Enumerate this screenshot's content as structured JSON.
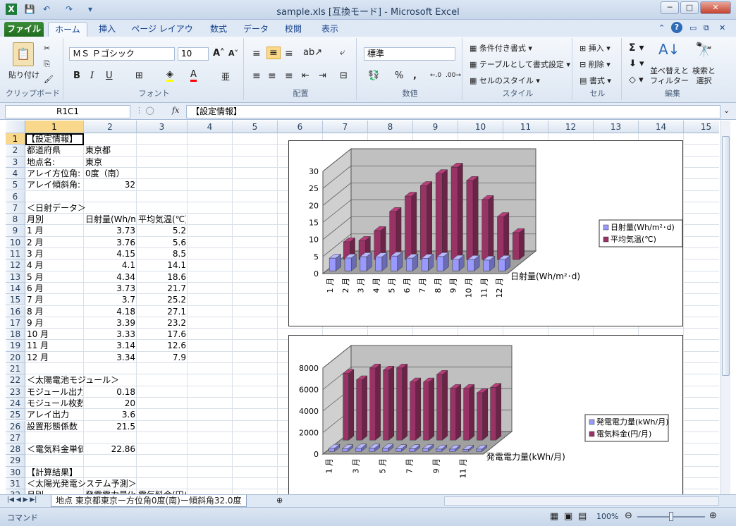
{
  "window": {
    "title": "sample.xls  [互換モード] - Microsoft Excel"
  },
  "tabs": [
    "ファイル",
    "ホーム",
    "挿入",
    "ページ レイアウト",
    "数式",
    "データ",
    "校閲",
    "表示"
  ],
  "ribbon": {
    "clipboard": {
      "label": "クリップボード",
      "paste": "貼り付け"
    },
    "font": {
      "label": "フォント",
      "name": "ＭＳ Ｐゴシック",
      "size": "10",
      "bold": "B",
      "italic": "I",
      "underline": "U"
    },
    "align": {
      "label": "配置"
    },
    "number": {
      "label": "数値",
      "format": "標準",
      "percent": "%",
      "comma": ","
    },
    "styles": {
      "label": "スタイル",
      "cond": "条件付き書式",
      "table": "テーブルとして書式設定",
      "cell": "セルのスタイル"
    },
    "cells": {
      "label": "セル",
      "insert": "挿入",
      "delete": "削除",
      "format": "書式"
    },
    "edit": {
      "label": "編集",
      "sort": "並べ替えと\nフィルター",
      "find": "検索と\n選択"
    }
  },
  "formula_bar": {
    "name_box": "R1C1",
    "fx": "fx",
    "value": "【設定情報】"
  },
  "columns": [
    "1",
    "2",
    "3",
    "4",
    "5",
    "6",
    "7",
    "8",
    "9",
    "10",
    "11",
    "12",
    "13",
    "14",
    "15"
  ],
  "rows": [
    {
      "n": "1",
      "a": "【設定情報】",
      "b": "",
      "c": ""
    },
    {
      "n": "2",
      "a": "都道府県",
      "b": "東京都",
      "c": ""
    },
    {
      "n": "3",
      "a": "地点名:",
      "b": "東京",
      "c": ""
    },
    {
      "n": "4",
      "a": "アレイ方位角:",
      "b": "0度（南）",
      "c": ""
    },
    {
      "n": "5",
      "a": "アレイ傾斜角:",
      "b": "32",
      "c": ""
    },
    {
      "n": "6",
      "a": "",
      "b": "",
      "c": ""
    },
    {
      "n": "7",
      "a": "＜日射データ＞",
      "b": "",
      "c": ""
    },
    {
      "n": "8",
      "a": "月別",
      "b": "日射量(Wh/m",
      "c": "平均気温(℃)"
    },
    {
      "n": "9",
      "a": "1 月",
      "b": "3.73",
      "c": "5.2"
    },
    {
      "n": "10",
      "a": "2 月",
      "b": "3.76",
      "c": "5.6"
    },
    {
      "n": "11",
      "a": "3 月",
      "b": "4.15",
      "c": "8.5"
    },
    {
      "n": "12",
      "a": "4 月",
      "b": "4.1",
      "c": "14.1"
    },
    {
      "n": "13",
      "a": "5 月",
      "b": "4.34",
      "c": "18.6"
    },
    {
      "n": "14",
      "a": "6 月",
      "b": "3.73",
      "c": "21.7"
    },
    {
      "n": "15",
      "a": "7 月",
      "b": "3.7",
      "c": "25.2"
    },
    {
      "n": "16",
      "a": "8 月",
      "b": "4.18",
      "c": "27.1"
    },
    {
      "n": "17",
      "a": "9 月",
      "b": "3.39",
      "c": "23.2"
    },
    {
      "n": "18",
      "a": "10 月",
      "b": "3.33",
      "c": "17.6"
    },
    {
      "n": "19",
      "a": "11 月",
      "b": "3.14",
      "c": "12.6"
    },
    {
      "n": "20",
      "a": "12 月",
      "b": "3.34",
      "c": "7.9"
    },
    {
      "n": "21",
      "a": "",
      "b": "",
      "c": ""
    },
    {
      "n": "22",
      "a": "＜太陽電池モジュール＞",
      "b": "",
      "c": ""
    },
    {
      "n": "23",
      "a": "モジュール出力",
      "b": "0.18",
      "c": ""
    },
    {
      "n": "24",
      "a": "モジュール枚数",
      "b": "20",
      "c": ""
    },
    {
      "n": "25",
      "a": "アレイ出力",
      "b": "3.6",
      "c": ""
    },
    {
      "n": "26",
      "a": "設置形態係数",
      "b": "21.5",
      "c": ""
    },
    {
      "n": "27",
      "a": "",
      "b": "",
      "c": ""
    },
    {
      "n": "28",
      "a": "＜電気料金単価",
      "b": "22.86",
      "c": ""
    },
    {
      "n": "29",
      "a": "",
      "b": "",
      "c": ""
    },
    {
      "n": "30",
      "a": "【計算結果】",
      "b": "",
      "c": ""
    },
    {
      "n": "31",
      "a": "＜太陽光発電システム予測＞",
      "b": "",
      "c": ""
    },
    {
      "n": "32",
      "a": "月別",
      "b": "発電電力量(k",
      "c": "電気料金(円/月)"
    }
  ],
  "chart_data": [
    {
      "type": "bar",
      "categories": [
        "1 月",
        "2 月",
        "3 月",
        "4 月",
        "5 月",
        "6 月",
        "7 月",
        "8 月",
        "9 月",
        "10 月",
        "11 月",
        "12 月"
      ],
      "series": [
        {
          "name": "日射量(Wh/m²･d)",
          "values": [
            3.73,
            3.76,
            4.15,
            4.1,
            4.34,
            3.73,
            3.7,
            4.18,
            3.39,
            3.33,
            3.14,
            3.34
          ],
          "color": "#9999ff"
        },
        {
          "name": "平均気温(℃)",
          "values": [
            5.2,
            5.6,
            8.5,
            14.1,
            18.6,
            21.7,
            25.2,
            27.1,
            23.2,
            17.6,
            12.6,
            7.9
          ],
          "color": "#993366"
        }
      ],
      "ylim": [
        0,
        30
      ],
      "yticks": [
        "0",
        "5",
        "10",
        "15",
        "20",
        "25",
        "30"
      ],
      "depth_label": "日射量(Wh/m²･d)",
      "legend": "right"
    },
    {
      "type": "bar",
      "categories": [
        "1 月",
        "2 月",
        "3 月",
        "4 月",
        "5 月",
        "6 月",
        "7 月",
        "8 月",
        "9 月",
        "10 月",
        "11 月",
        "12 月"
      ],
      "xticks": [
        "1 月",
        "3 月",
        "5 月",
        "7 月",
        "9 月",
        "11 月"
      ],
      "series": [
        {
          "name": "発電電力量(kWh/月)",
          "values": [
            280,
            250,
            300,
            300,
            300,
            240,
            240,
            270,
            210,
            210,
            190,
            210
          ],
          "color": "#9999ff"
        },
        {
          "name": "電気料金(円/月)",
          "values": [
            6200,
            5600,
            6700,
            6500,
            6700,
            5400,
            5400,
            6100,
            4800,
            4800,
            4400,
            4900
          ],
          "color": "#993366"
        }
      ],
      "ylim": [
        0,
        8000
      ],
      "yticks": [
        "0",
        "2000",
        "4000",
        "6000",
        "8000"
      ],
      "depth_label": "発電電力量(kWh/月)",
      "legend": "right"
    }
  ],
  "sheet_tab": "地点 東京都東京ー方位角0度(南)ー傾斜角32.0度",
  "status": {
    "mode": "コマンド",
    "zoom": "100%"
  }
}
